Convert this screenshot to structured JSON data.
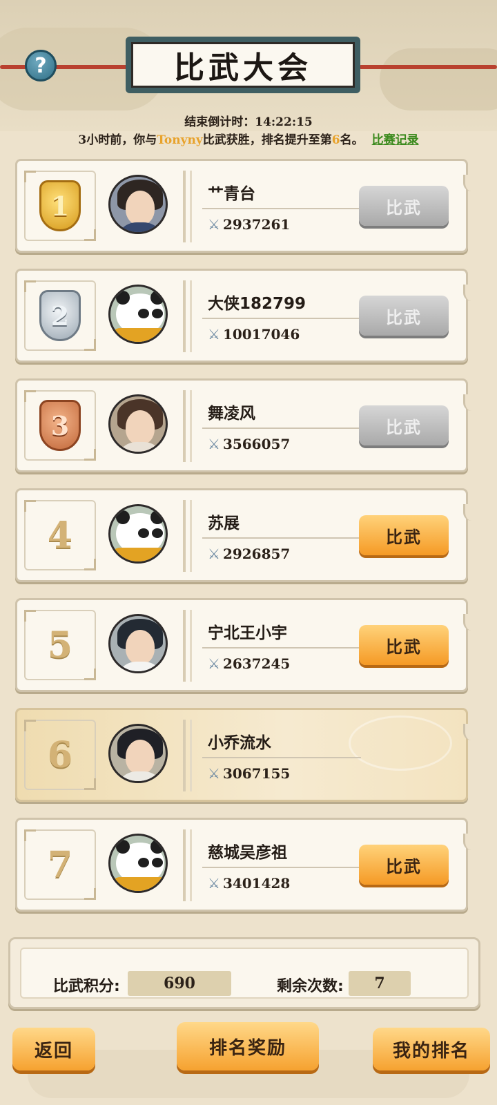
{
  "header": {
    "title": "比武大会",
    "help_glyph": "?",
    "countdown_label": "结束倒计时：",
    "countdown_value": "14:22:15",
    "notice_prefix": "3小时前，你与",
    "notice_player": "Tonyny",
    "notice_middle": "比武获胜，排名提升至第",
    "notice_rank": "6",
    "notice_suffix": "名。",
    "record_link": "比赛记录"
  },
  "rankings": [
    {
      "rank": "1",
      "name": "艹青台",
      "power": "2937261",
      "button": "比武",
      "button_state": "disabled",
      "medal": "gold",
      "avatar": "female-warrior"
    },
    {
      "rank": "2",
      "name": "大侠182799",
      "power": "10017046",
      "button": "比武",
      "button_state": "disabled",
      "medal": "silver",
      "avatar": "panda"
    },
    {
      "rank": "3",
      "name": "舞凌风",
      "power": "3566057",
      "button": "比武",
      "button_state": "disabled",
      "medal": "bronze",
      "avatar": "female-dancer"
    },
    {
      "rank": "4",
      "name": "苏展",
      "power": "2926857",
      "button": "比武",
      "button_state": "active",
      "medal": "none",
      "avatar": "panda"
    },
    {
      "rank": "5",
      "name": "宁北王小宇",
      "power": "2637245",
      "button": "比武",
      "button_state": "active",
      "medal": "none",
      "avatar": "male-swordsman"
    },
    {
      "rank": "6",
      "name": "小乔流水",
      "power": "3067155",
      "button": "",
      "button_state": "self",
      "medal": "none",
      "avatar": "male-scholar"
    },
    {
      "rank": "7",
      "name": "慈城吴彦祖",
      "power": "3401428",
      "button": "比武",
      "button_state": "active",
      "medal": "none",
      "avatar": "panda"
    }
  ],
  "stats": {
    "points_label": "比武积分:",
    "points_value": "690",
    "remaining_label": "剩余次数:",
    "remaining_value": "7"
  },
  "footer": {
    "back": "返回",
    "rewards": "排名奖励",
    "my_rank": "我的排名"
  },
  "icons": {
    "power": "crossed-swords-icon",
    "help": "question-icon"
  },
  "colors": {
    "accent_orange": "#f59a25",
    "highlight_player": "#e8a22b",
    "record_link": "#3b8a1d"
  }
}
